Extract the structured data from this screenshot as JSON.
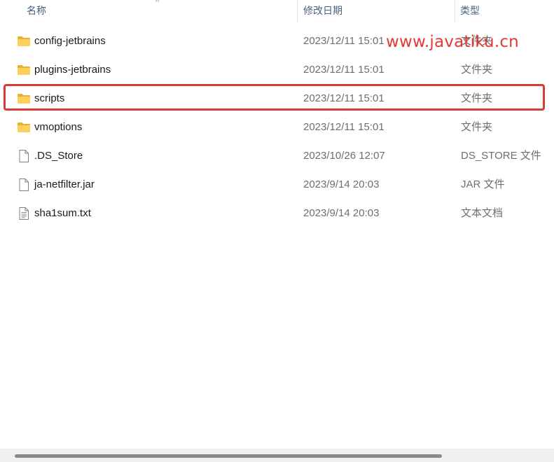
{
  "header": {
    "name_label": "名称",
    "date_label": "修改日期",
    "type_label": "类型",
    "sort_indicator": "^"
  },
  "files": [
    {
      "icon": "folder-icon",
      "name": "config-jetbrains",
      "date": "2023/12/11 15:01",
      "type": "文件夹"
    },
    {
      "icon": "folder-icon",
      "name": "plugins-jetbrains",
      "date": "2023/12/11 15:01",
      "type": "文件夹"
    },
    {
      "icon": "folder-icon",
      "name": "scripts",
      "date": "2023/12/11 15:01",
      "type": "文件夹"
    },
    {
      "icon": "folder-icon",
      "name": "vmoptions",
      "date": "2023/12/11 15:01",
      "type": "文件夹"
    },
    {
      "icon": "file-icon",
      "name": ".DS_Store",
      "date": "2023/10/26 12:07",
      "type": "DS_STORE 文件"
    },
    {
      "icon": "file-icon",
      "name": "ja-netfilter.jar",
      "date": "2023/9/14 20:03",
      "type": "JAR 文件"
    },
    {
      "icon": "text-file-icon",
      "name": "sha1sum.txt",
      "date": "2023/9/14 20:03",
      "type": "文本文档"
    }
  ],
  "watermark": "www.javatiku.cn",
  "colors": {
    "highlight": "#d93a34",
    "watermark": "#e53935",
    "folder": "#f5c342"
  }
}
